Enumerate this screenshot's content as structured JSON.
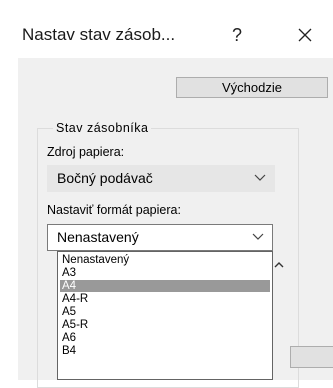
{
  "window": {
    "title": "Nastav stav zásob...",
    "help_label": "?",
    "close_icon": "close-icon"
  },
  "buttons": {
    "default_label": "Východzie"
  },
  "group": {
    "legend": "Stav zásobníka",
    "source_label": "Zdroj papiera:",
    "source_value": "Bočný podávač",
    "format_label": "Nastaviť formát papiera:",
    "format_value": "Nenastavený"
  },
  "dropdown": {
    "items": [
      "Nenastavený",
      "A3",
      "A4",
      "A4-R",
      "A5",
      "A5-R",
      "A6",
      "B4"
    ],
    "selected": "A4"
  },
  "colors": {
    "client_bg": "#f0f0f0",
    "selection_bg": "#999999"
  }
}
